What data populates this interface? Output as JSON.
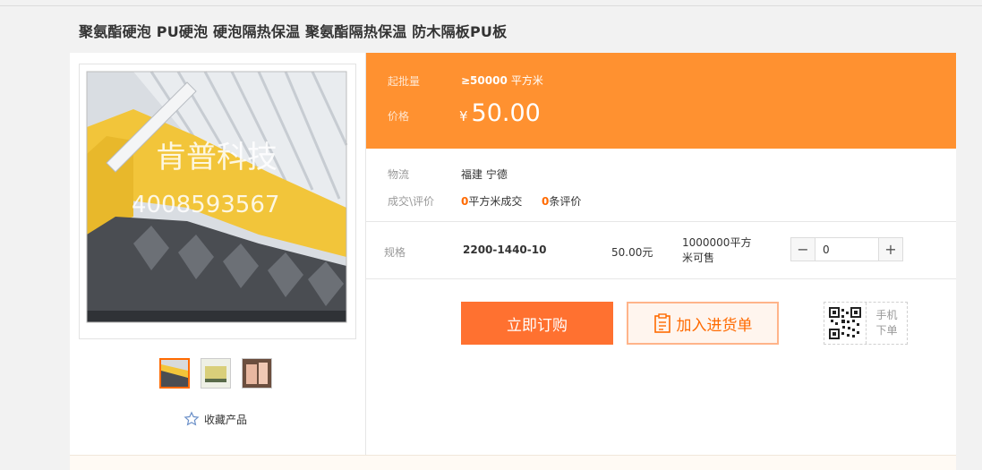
{
  "product": {
    "title": "聚氨酯硬泡 PU硬泡 硬泡隔热保温 聚氨酯隔热保温 防木隔板PU板",
    "image_watermark": {
      "company": "肯普科技",
      "phone": "4008593567"
    }
  },
  "price_panel": {
    "moq_label": "起批量",
    "moq_value": "≥50000",
    "moq_unit": "平方米",
    "price_label": "价格",
    "currency": "¥",
    "price": "50.00"
  },
  "info": {
    "logistics_label": "物流",
    "logistics_value": "福建 宁德",
    "deal_label": "成交\\评价",
    "deal_count": "0",
    "deal_suffix": "平方米成交",
    "review_count": "0",
    "review_suffix": "条评价"
  },
  "spec": {
    "label": "规格",
    "name": "2200-1440-10",
    "unit_price": "50.00元",
    "stock_line1": "1000000平方",
    "stock_line2": "米可售",
    "quantity": "0"
  },
  "actions": {
    "buy_now": "立即订购",
    "add_to_cart": "加入进货单",
    "mobile_line1": "手机",
    "mobile_line2": "下单"
  },
  "favorite": {
    "label": "收藏产品"
  },
  "colors": {
    "accent": "#ff9130",
    "buy": "#ff7130",
    "orange_text": "#ff6a00"
  }
}
